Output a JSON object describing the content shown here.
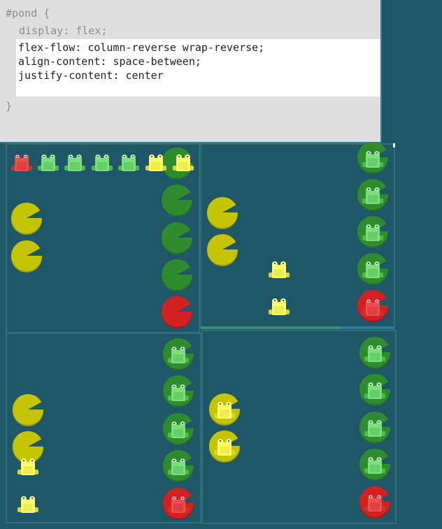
{
  "editor": {
    "line_open": "#pond {",
    "line_display": "display: flex;",
    "answer_lines": [
      "flex-flow: column-reverse wrap-reverse;",
      "align-content: space-between;",
      "justify-content: center"
    ],
    "line_close": "}"
  },
  "colors": {
    "water": "#1f5768",
    "editor_bg": "#dfdfdf",
    "pad_green": "#2e8b2e",
    "pad_yellow": "#c4c400",
    "pad_red": "#d32020",
    "frog_green": "#7be07b",
    "frog_yellow": "#ffff66",
    "frog_red": "#ef4d4d"
  }
}
